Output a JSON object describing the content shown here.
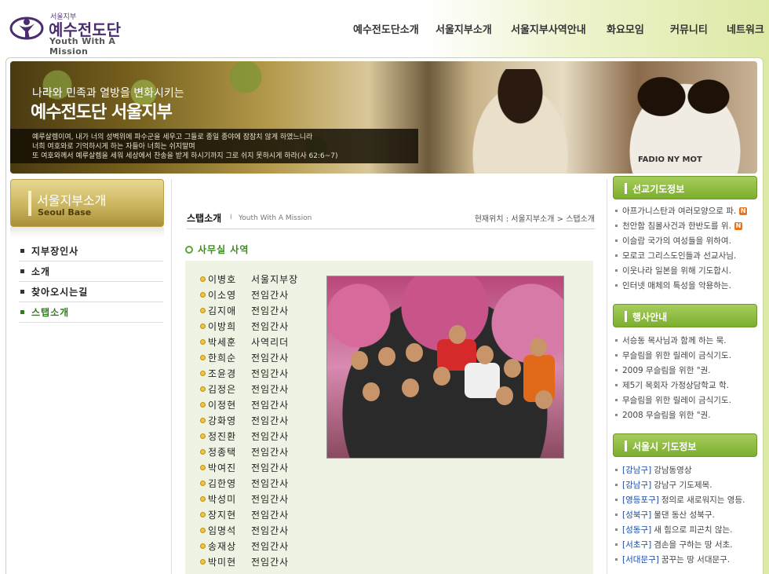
{
  "logo": {
    "small": "서울지부",
    "korean": "예수전도단",
    "english": "Youth With A Mission"
  },
  "gnb": [
    "예수전도단소개",
    "서울지부소개",
    "서울지부사역안내",
    "화요모임",
    "커뮤니티",
    "네트워크"
  ],
  "banner": {
    "tagline": "나라와 민족과 열방을 변화시키는",
    "title": "예수전도단 서울지부",
    "verse": [
      "예루살렘이여, 내가 너의 성벽위에 파수군을 세우고 그들로 종일 종야에 잠잠치 않게 하였느니라",
      "너희 여호와로 기억하시게 하는 자들아 너희는 쉬지말며",
      "또 여호와께서 예루살렘을 세워 세상에서 찬송을 받게 하시기까지 그로 쉬지 못하시게 하라(사 62:6~7)"
    ],
    "shirt_text": "FADIO NY MOT"
  },
  "lnb": {
    "title_ko": "서울지부소개",
    "title_en": "Seoul Base",
    "items": [
      {
        "label": "지부장인사",
        "active": false
      },
      {
        "label": "소개",
        "active": false
      },
      {
        "label": "찾아오시는길",
        "active": false
      },
      {
        "label": "스탭소개",
        "active": true
      }
    ]
  },
  "content": {
    "title": "스탭소개",
    "separator": "I",
    "subtitle": "Youth With A Mission",
    "location": "현재위치 : 서울지부소개 > 스탭소개",
    "section_title": "사무실 사역",
    "staff": [
      {
        "name": "이병호",
        "role": "서울지부장"
      },
      {
        "name": "이소영",
        "role": "전임간사"
      },
      {
        "name": "김지애",
        "role": "전임간사"
      },
      {
        "name": "이방희",
        "role": "전임간사"
      },
      {
        "name": "박세훈",
        "role": "사역리더"
      },
      {
        "name": "한희순",
        "role": "전임간사"
      },
      {
        "name": "조윤경",
        "role": "전임간사"
      },
      {
        "name": "김정은",
        "role": "전임간사"
      },
      {
        "name": "이정현",
        "role": "전임간사"
      },
      {
        "name": "강화영",
        "role": "전임간사"
      },
      {
        "name": "정진환",
        "role": "전임간사"
      },
      {
        "name": "정종택",
        "role": "전임간사"
      },
      {
        "name": "박여진",
        "role": "전임간사"
      },
      {
        "name": "김한영",
        "role": "전임간사"
      },
      {
        "name": "박성미",
        "role": "전임간사"
      },
      {
        "name": "장지현",
        "role": "전임간사"
      },
      {
        "name": "임명석",
        "role": "전임간사"
      },
      {
        "name": "송재상",
        "role": "전임간사"
      },
      {
        "name": "박미현",
        "role": "전임간사"
      }
    ]
  },
  "side": {
    "prayer": {
      "title": "선교기도정보",
      "items": [
        {
          "text": "아프가니스탄과 여러모양으로 파.",
          "new": true
        },
        {
          "text": "천안함 침몰사건과 한반도를 위.",
          "new": true
        },
        {
          "text": "이슬람 국가의 여성들을 위하여.",
          "new": false
        },
        {
          "text": "모로코 그리스도인들과 선교사님.",
          "new": false
        },
        {
          "text": "이웃나라 일본을 위해 기도합시.",
          "new": false
        },
        {
          "text": "인터넷 매체의 특성을 악용하는.",
          "new": false
        }
      ],
      "new_label": "N"
    },
    "events": {
      "title": "행사안내",
      "items": [
        "서승동 목사님과 함께 하는 묵.",
        "무슬림을 위한 릴레이 금식기도.",
        "2009 무슬림을 위한 \"권.",
        "제5기 목회자 가정상담학교 학.",
        "무슬림을 위한 릴레이 금식기도.",
        "2008 무슬림을 위한 \"권."
      ]
    },
    "seoul": {
      "title": "서울시 기도정보",
      "items": [
        {
          "gu": "[강남구]",
          "text": "강남동영상"
        },
        {
          "gu": "[강남구]",
          "text": "강남구 기도제목."
        },
        {
          "gu": "[영등포구]",
          "text": "정의로 새로워지는 영등."
        },
        {
          "gu": "[성북구]",
          "text": "물댄 동산 성북구."
        },
        {
          "gu": "[성동구]",
          "text": "새 힘으로 피곤치 않는."
        },
        {
          "gu": "[서초구]",
          "text": "겸손을 구하는 땅 서초."
        },
        {
          "gu": "[서대문구]",
          "text": "꿈꾸는 땅 서대문구."
        }
      ]
    }
  },
  "colors": {
    "accent_green": "#3e8a24",
    "side_header": "#8bbd3c",
    "gold": "#c9b25c"
  }
}
